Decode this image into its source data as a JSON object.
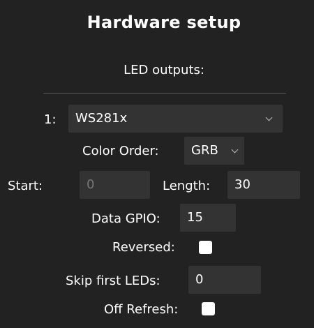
{
  "header": {
    "title": "Hardware setup",
    "subtitle": "LED outputs:"
  },
  "output": {
    "index_label": "1:",
    "type_value": "WS281x",
    "color_order_label": "Color Order:",
    "color_order_value": "GRB",
    "start_label": "Start:",
    "start_value": "0",
    "length_label": "Length:",
    "length_value": "30",
    "gpio_label": "Data GPIO:",
    "gpio_value": "15",
    "reversed_label": "Reversed:",
    "skip_label": "Skip first LEDs:",
    "skip_value": "0",
    "off_refresh_label": "Off Refresh:"
  },
  "icons": {
    "type_dropdown": "chevron-down-icon",
    "color_order_dropdown": "chevron-down-icon"
  },
  "colors": {
    "background": "#222222",
    "field": "#333333",
    "text": "#ffffff",
    "muted_text": "#777777"
  }
}
